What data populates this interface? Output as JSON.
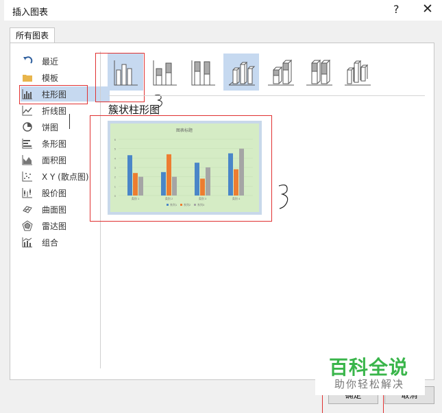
{
  "dialog": {
    "title": "插入图表",
    "help_label": "?",
    "close_label": "✕",
    "tab_label": "所有图表"
  },
  "categories": [
    {
      "label": "最近",
      "icon": "undo-arrow-icon"
    },
    {
      "label": "模板",
      "icon": "folder-icon"
    },
    {
      "label": "柱形图",
      "icon": "column-chart-icon",
      "selected": true
    },
    {
      "label": "折线图",
      "icon": "line-chart-icon"
    },
    {
      "label": "饼图",
      "icon": "pie-chart-icon"
    },
    {
      "label": "条形图",
      "icon": "bar-chart-icon"
    },
    {
      "label": "面积图",
      "icon": "area-chart-icon"
    },
    {
      "label": "X Y (散点图)",
      "icon": "scatter-chart-icon"
    },
    {
      "label": "股价图",
      "icon": "stock-chart-icon"
    },
    {
      "label": "曲面图",
      "icon": "surface-chart-icon"
    },
    {
      "label": "雷达图",
      "icon": "radar-chart-icon"
    },
    {
      "label": "组合",
      "icon": "combo-chart-icon"
    }
  ],
  "subtypes_heading": "簇状柱形图",
  "preview_chart": {
    "title": "图表标题",
    "chart_data": {
      "type": "bar",
      "categories": [
        "类别 1",
        "类别 2",
        "类别 3",
        "类别 4"
      ],
      "series": [
        {
          "name": "系列1",
          "values": [
            4.3,
            2.5,
            3.5,
            4.5
          ],
          "color": "#4a86c8"
        },
        {
          "name": "系列2",
          "values": [
            2.4,
            4.4,
            1.8,
            2.8
          ],
          "color": "#ed7d31"
        },
        {
          "name": "系列3",
          "values": [
            2.0,
            2.0,
            3.0,
            5.0
          ],
          "color": "#a5a5a5"
        }
      ],
      "ylim": [
        0,
        6
      ],
      "yticks": [
        "0",
        "1",
        "2",
        "3",
        "4",
        "5",
        "6"
      ],
      "legend": "bottom"
    }
  },
  "buttons": {
    "ok": "确定",
    "cancel": "取消"
  },
  "watermark": {
    "line1": "百科全说",
    "line2": "助你轻松解决"
  },
  "colors": {
    "selection": "#c6d9f0",
    "annotation_red": "#e03030",
    "watermark_green": "#39b54a"
  }
}
